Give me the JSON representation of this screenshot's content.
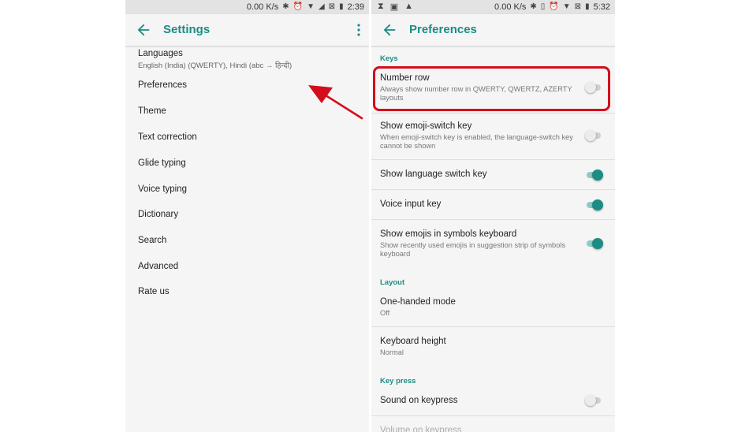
{
  "left_phone": {
    "status": {
      "speed": "0.00 K/s",
      "time": "2:39"
    },
    "appbar": {
      "title": "Settings",
      "back_icon": "arrow-back-icon",
      "more_icon": "more-vert-icon"
    },
    "menu": [
      {
        "label": "Languages",
        "sub": "English (India) (QWERTY), Hindi (abc → हिन्दी)"
      },
      {
        "label": "Preferences"
      },
      {
        "label": "Theme"
      },
      {
        "label": "Text correction"
      },
      {
        "label": "Glide typing"
      },
      {
        "label": "Voice typing"
      },
      {
        "label": "Dictionary"
      },
      {
        "label": "Search"
      },
      {
        "label": "Advanced"
      },
      {
        "label": "Rate us"
      }
    ]
  },
  "right_phone": {
    "status": {
      "speed": "0.00 K/s",
      "time": "5:32"
    },
    "appbar": {
      "title": "Preferences",
      "back_icon": "arrow-back-icon"
    },
    "sections": {
      "keys": "Keys",
      "layout": "Layout",
      "keypress": "Key press"
    },
    "rows": {
      "number_row": {
        "title": "Number row",
        "sub": "Always show number row in QWERTY, QWERTZ, AZERTY layouts",
        "on": false
      },
      "emoji_switch": {
        "title": "Show emoji-switch key",
        "sub": "When emoji-switch key is enabled, the language-switch key cannot be shown",
        "on": false
      },
      "language_switch": {
        "title": "Show language switch key",
        "on": true
      },
      "voice_input": {
        "title": "Voice input key",
        "on": true
      },
      "emojis_symbols": {
        "title": "Show emojis in symbols keyboard",
        "sub": "Show recently used emojis in suggestion strip of symbols keyboard",
        "on": true
      },
      "one_handed": {
        "title": "One-handed mode",
        "value": "Off"
      },
      "keyboard_height": {
        "title": "Keyboard height",
        "value": "Normal"
      },
      "sound_keypress": {
        "title": "Sound on keypress",
        "on": false
      },
      "volume_keypress": {
        "title": "Volume on keypress"
      }
    }
  },
  "colors": {
    "accent": "#1b8d84",
    "highlight": "#d40d1b",
    "background": "#f5f5f5"
  }
}
